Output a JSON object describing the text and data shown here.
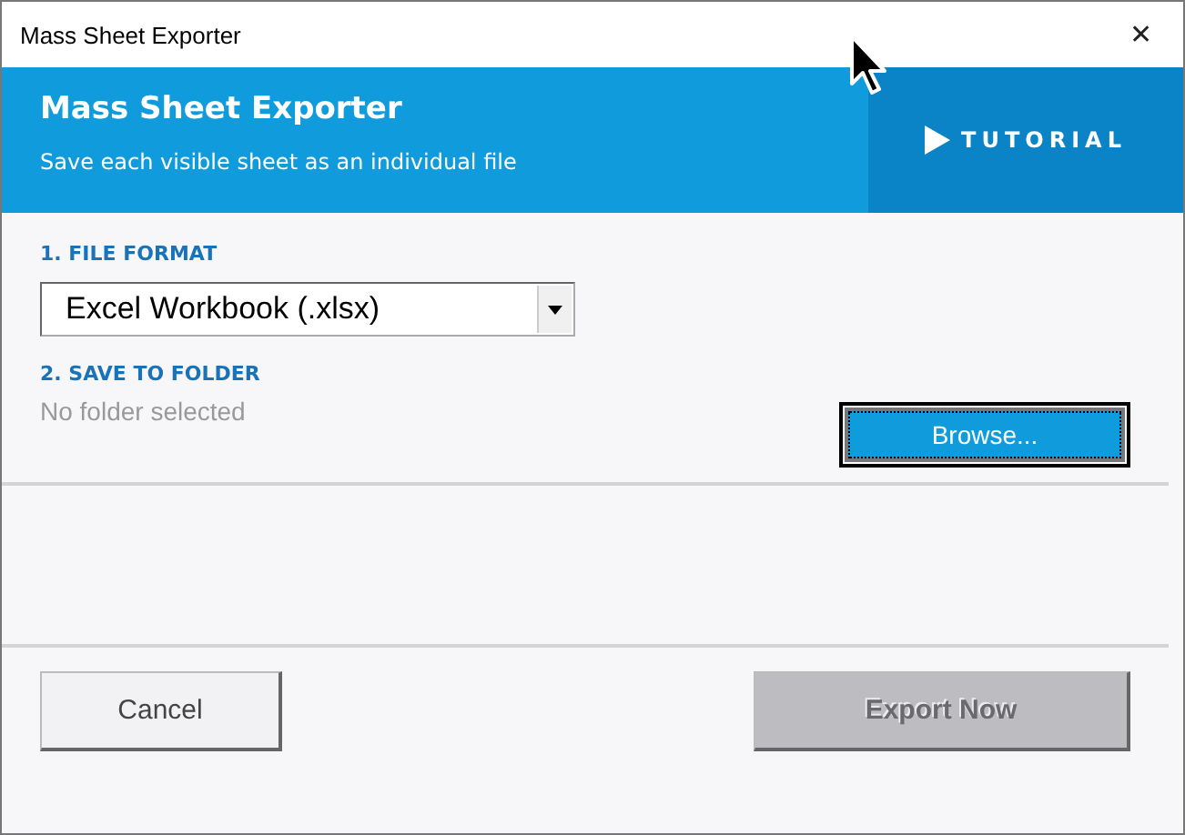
{
  "window": {
    "title": "Mass Sheet Exporter",
    "close": "✕"
  },
  "header": {
    "title": "Mass Sheet Exporter",
    "subtitle": "Save each visible sheet as an individual file",
    "tutorial": "TUTORIAL"
  },
  "file_format": {
    "label": "1. FILE FORMAT",
    "value": "Excel Workbook (.xlsx)"
  },
  "save_folder": {
    "label": "2. SAVE TO FOLDER",
    "path": "No folder selected",
    "browse": {
      "label": "Browse...",
      "focused": true
    }
  },
  "buttons": [
    {
      "label": "Cancel",
      "disabled": false
    },
    {
      "label": "Export Now",
      "disabled": true
    }
  ]
}
